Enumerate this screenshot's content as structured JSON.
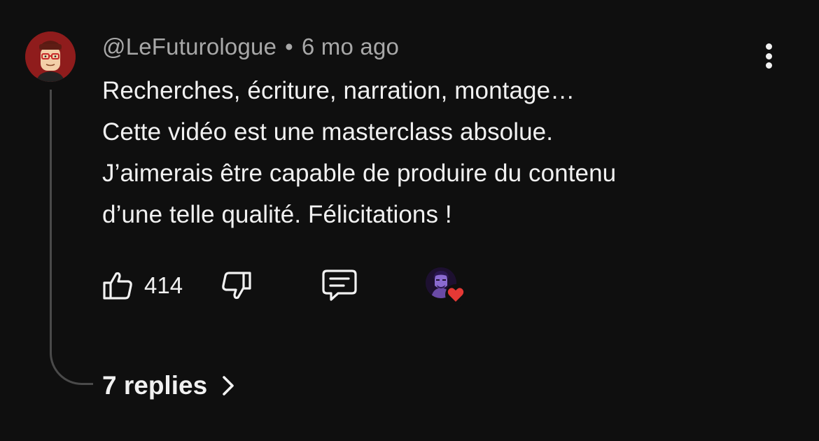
{
  "comment": {
    "author": "@LeFuturologue",
    "separator": "•",
    "timestamp": "6 mo ago",
    "text_lines": [
      "Recherches, écriture, narration, montage…",
      "Cette vidéo est une masterclass absolue.",
      "J’aimerais être capable de produire du contenu",
      "d’une telle qualité. Félicitations !"
    ],
    "likes": "414",
    "replies_label": "7 replies"
  },
  "icons": {
    "avatar": "cartoon-face-avatar",
    "more": "more-vert-icon",
    "like": "thumb-up-icon",
    "dislike": "thumb-down-icon",
    "reply": "comment-bubble-icon",
    "creator_heart": "creator-heart-badge",
    "chevron": "chevron-right-icon"
  },
  "colors": {
    "background": "#0f0f0f",
    "text": "#f1f1f1",
    "meta": "#a8a8a8",
    "avatar_bg": "#8f1c1c",
    "heart": "#e53935"
  }
}
